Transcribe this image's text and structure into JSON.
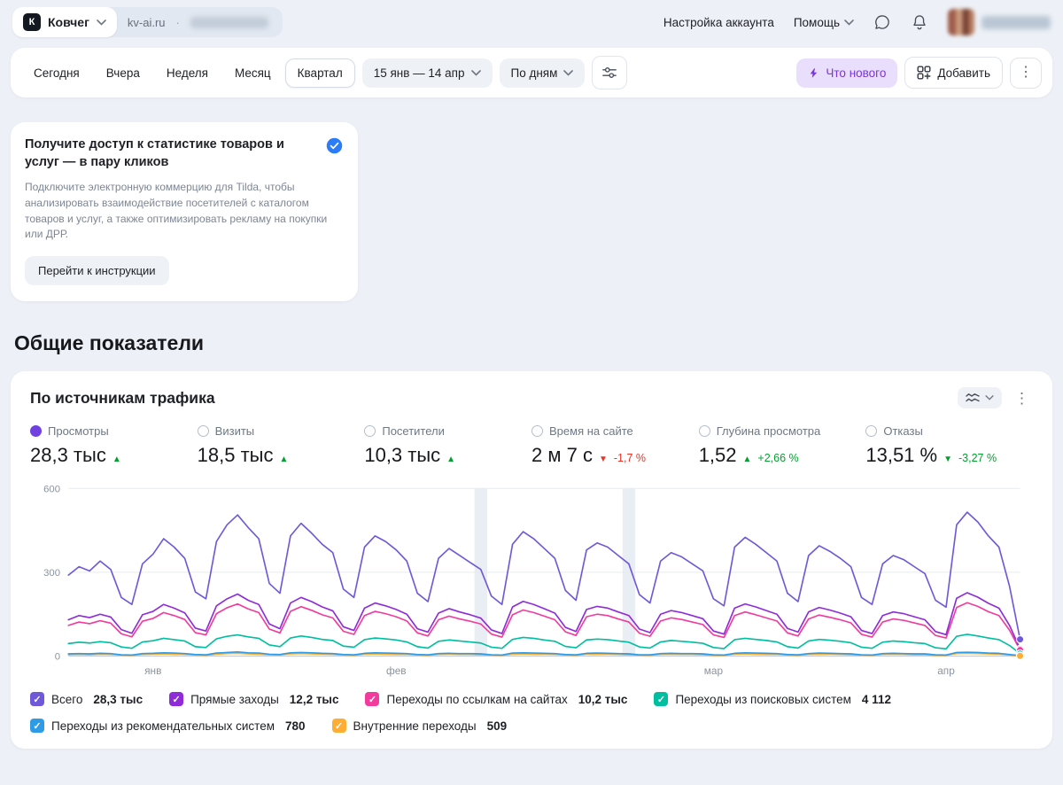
{
  "icons": {
    "kebab": "⋮",
    "separator_dot": "·",
    "up_triangle": "▲",
    "down_triangle": "▼",
    "checkmark": "✓"
  },
  "header": {
    "counter_name": "Ковчег",
    "site_domain": "kv-ai.ru",
    "account_settings_label": "Настройка аккаунта",
    "help_label": "Помощь"
  },
  "toolbar": {
    "periods": [
      "Сегодня",
      "Вчера",
      "Неделя",
      "Месяц",
      "Квартал"
    ],
    "selected_period": "Квартал",
    "date_range_label": "15 янв — 14 апр",
    "granularity_label": "По дням",
    "whats_new_label": "Что нового",
    "add_label": "Добавить"
  },
  "promo": {
    "title": "Получите доступ к статистике товаров и услуг — в пару кликов",
    "body": "Подключите электронную коммерцию для Tilda, чтобы анализировать взаимодействие посетителей с каталогом товаров и услуг, а также оптимизировать рекламу на покупки или ДРР.",
    "button_label": "Перейти к инструкции"
  },
  "section_title": "Общие показатели",
  "widget": {
    "title": "По источникам трафика",
    "selected_metric_index": 0,
    "metrics": [
      {
        "label": "Просмотры",
        "value": "28,3 тыс",
        "trend": "up",
        "trend_color": "green",
        "delta": ""
      },
      {
        "label": "Визиты",
        "value": "18,5 тыс",
        "trend": "up",
        "trend_color": "green",
        "delta": ""
      },
      {
        "label": "Посетители",
        "value": "10,3 тыс",
        "trend": "up",
        "trend_color": "green",
        "delta": ""
      },
      {
        "label": "Время на сайте",
        "value": "2 м 7 с",
        "trend": "down",
        "trend_color": "red",
        "delta": "-1,7 %"
      },
      {
        "label": "Глубина просмотра",
        "value": "1,52",
        "trend": "up",
        "trend_color": "green",
        "delta": "+2,66 %"
      },
      {
        "label": "Отказы",
        "value": "13,51 %",
        "trend": "down",
        "trend_color": "green",
        "delta": "-3,27 %"
      }
    ],
    "legend": [
      {
        "label": "Всего",
        "value": "28,3 тыс",
        "color": "#7059D9"
      },
      {
        "label": "Прямые заходы",
        "value": "12,2 тыс",
        "color": "#8F2BD9"
      },
      {
        "label": "Переходы по ссылкам на сайтах",
        "value": "10,2 тыс",
        "color": "#F23B9C"
      },
      {
        "label": "Переходы из поисковых систем",
        "value": "4 112",
        "color": "#00BFA0"
      },
      {
        "label": "Переходы из рекомендательных систем",
        "value": "780",
        "color": "#2E9BE6"
      },
      {
        "label": "Внутренние переходы",
        "value": "509",
        "color": "#FFAE33"
      }
    ],
    "legend_row_break": 4
  },
  "chart_data": {
    "type": "line",
    "title": "По источникам трафика",
    "x_range": [
      "15 янв",
      "14 апр"
    ],
    "x_unit": "день",
    "ylim": [
      0,
      600
    ],
    "yticks": [
      0,
      300,
      600
    ],
    "x_months": [
      {
        "label": "янв",
        "day": 8
      },
      {
        "label": "фев",
        "day": 31
      },
      {
        "label": "мар",
        "day": 61
      },
      {
        "label": "апр",
        "day": 83
      }
    ],
    "holiday_band_days": [
      39,
      53
    ],
    "series": [
      {
        "name": "Всего",
        "color": "#7059D9",
        "values": [
          290,
          320,
          305,
          340,
          310,
          210,
          185,
          330,
          365,
          420,
          390,
          350,
          230,
          205,
          410,
          470,
          505,
          460,
          420,
          260,
          225,
          430,
          475,
          440,
          400,
          370,
          240,
          210,
          390,
          430,
          410,
          380,
          340,
          225,
          195,
          350,
          385,
          360,
          335,
          310,
          215,
          185,
          400,
          445,
          420,
          385,
          350,
          235,
          200,
          380,
          405,
          390,
          360,
          330,
          220,
          190,
          340,
          370,
          355,
          330,
          305,
          205,
          180,
          390,
          425,
          400,
          370,
          340,
          225,
          195,
          360,
          395,
          375,
          350,
          320,
          210,
          185,
          330,
          360,
          345,
          320,
          295,
          200,
          175,
          470,
          515,
          480,
          430,
          390,
          250,
          60
        ]
      },
      {
        "name": "Прямые заходы",
        "color": "#8F2BD9",
        "values": [
          130,
          145,
          138,
          150,
          140,
          95,
          82,
          148,
          160,
          185,
          172,
          155,
          100,
          90,
          180,
          205,
          222,
          200,
          185,
          115,
          98,
          190,
          210,
          195,
          176,
          162,
          105,
          92,
          172,
          190,
          180,
          167,
          150,
          98,
          86,
          154,
          170,
          158,
          148,
          136,
          94,
          81,
          176,
          196,
          185,
          170,
          154,
          103,
          88,
          167,
          178,
          172,
          158,
          145,
          97,
          84,
          150,
          163,
          156,
          145,
          134,
          90,
          79,
          172,
          187,
          176,
          163,
          150,
          99,
          86,
          158,
          174,
          165,
          154,
          141,
          92,
          81,
          145,
          158,
          152,
          141,
          130,
          88,
          77,
          207,
          227,
          211,
          189,
          172,
          110,
          26
        ]
      },
      {
        "name": "Переходы по ссылкам на сайтах",
        "color": "#F23B9C",
        "values": [
          110,
          122,
          116,
          127,
          118,
          80,
          69,
          125,
          135,
          156,
          145,
          131,
          84,
          76,
          152,
          173,
          187,
          169,
          156,
          97,
          83,
          160,
          177,
          164,
          148,
          137,
          89,
          78,
          145,
          160,
          152,
          141,
          126,
          83,
          72,
          130,
          143,
          133,
          125,
          115,
          79,
          68,
          148,
          165,
          156,
          143,
          130,
          87,
          74,
          141,
          150,
          145,
          133,
          122,
          82,
          71,
          126,
          137,
          131,
          122,
          113,
          76,
          67,
          145,
          158,
          148,
          137,
          126,
          83,
          72,
          133,
          147,
          139,
          130,
          119,
          78,
          68,
          122,
          133,
          128,
          119,
          110,
          74,
          65,
          174,
          191,
          178,
          159,
          145,
          93,
          22
        ]
      },
      {
        "name": "Переходы из поисковых систем",
        "color": "#00BFA0",
        "values": [
          45,
          50,
          47,
          52,
          48,
          33,
          28,
          51,
          55,
          64,
          59,
          54,
          34,
          31,
          62,
          71,
          76,
          69,
          64,
          40,
          34,
          65,
          72,
          67,
          60,
          56,
          36,
          32,
          59,
          65,
          62,
          58,
          51,
          34,
          29,
          53,
          58,
          54,
          51,
          47,
          32,
          28,
          60,
          67,
          64,
          58,
          53,
          35,
          30,
          58,
          61,
          59,
          54,
          50,
          33,
          29,
          51,
          56,
          53,
          50,
          46,
          31,
          27,
          59,
          64,
          60,
          56,
          51,
          34,
          29,
          54,
          60,
          57,
          53,
          48,
          32,
          28,
          50,
          54,
          52,
          48,
          45,
          30,
          26,
          71,
          78,
          72,
          65,
          59,
          38,
          9
        ]
      },
      {
        "name": "Переходы из рекомендательных систем",
        "color": "#2E9BE6",
        "values": [
          8,
          9,
          8,
          10,
          9,
          5,
          4,
          9,
          10,
          12,
          11,
          9,
          6,
          5,
          11,
          13,
          15,
          12,
          11,
          7,
          6,
          12,
          13,
          12,
          10,
          9,
          6,
          5,
          10,
          12,
          11,
          10,
          9,
          6,
          5,
          9,
          10,
          9,
          9,
          8,
          5,
          4,
          11,
          12,
          11,
          10,
          9,
          6,
          5,
          10,
          11,
          10,
          9,
          8,
          5,
          5,
          9,
          10,
          9,
          9,
          8,
          5,
          4,
          10,
          12,
          11,
          10,
          9,
          6,
          5,
          9,
          11,
          10,
          9,
          8,
          5,
          4,
          9,
          10,
          9,
          8,
          8,
          5,
          4,
          13,
          14,
          13,
          11,
          10,
          6,
          2
        ]
      },
      {
        "name": "Внутренние переходы",
        "color": "#FFAE33",
        "values": [
          5,
          6,
          5,
          7,
          6,
          4,
          3,
          6,
          7,
          8,
          7,
          6,
          4,
          3,
          7,
          9,
          10,
          8,
          7,
          5,
          4,
          8,
          9,
          8,
          7,
          6,
          4,
          3,
          7,
          8,
          7,
          6,
          6,
          4,
          3,
          6,
          7,
          6,
          6,
          5,
          4,
          3,
          7,
          8,
          7,
          7,
          6,
          4,
          3,
          7,
          7,
          7,
          6,
          5,
          4,
          3,
          6,
          7,
          6,
          6,
          5,
          3,
          3,
          7,
          8,
          7,
          6,
          6,
          4,
          3,
          6,
          7,
          7,
          6,
          5,
          4,
          3,
          6,
          7,
          6,
          5,
          5,
          3,
          3,
          9,
          10,
          9,
          8,
          7,
          4,
          1
        ]
      }
    ]
  }
}
